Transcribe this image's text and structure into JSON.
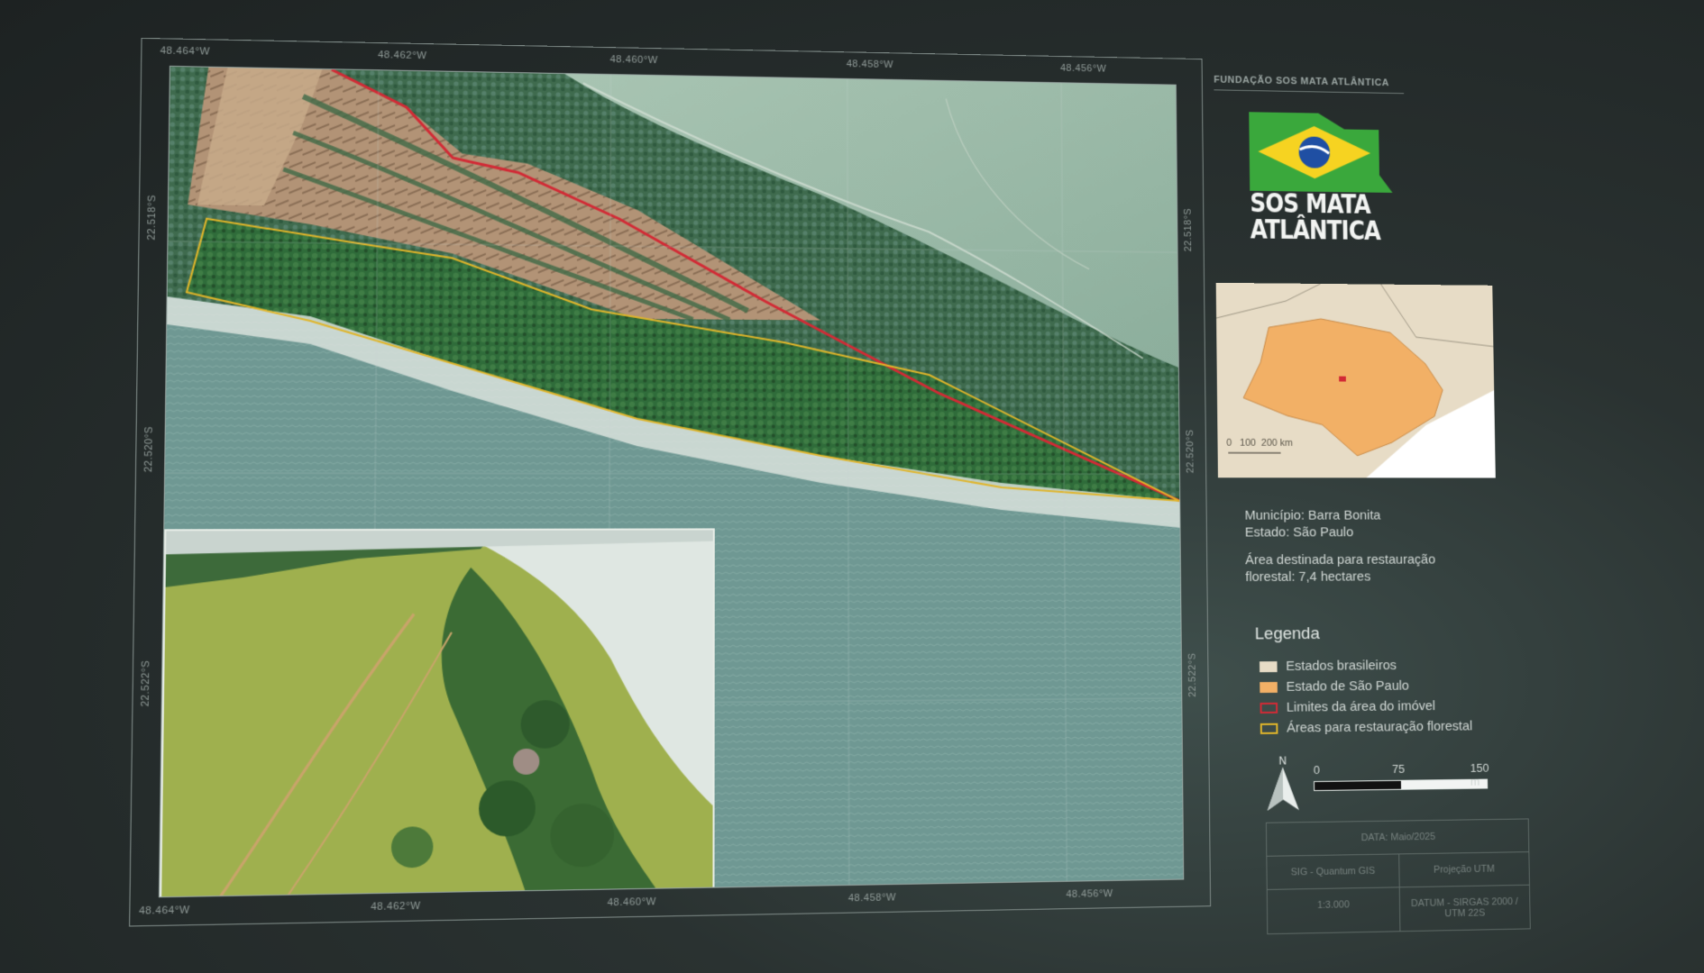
{
  "coords": {
    "top": [
      "48.464°W",
      "48.462°W",
      "48.460°W",
      "48.458°W",
      "48.456°W"
    ],
    "bottom": [
      "48.464°W",
      "48.462°W",
      "48.460°W",
      "48.458°W",
      "48.456°W"
    ],
    "left": [
      "22.518°S",
      "22.520°S",
      "22.522°S"
    ],
    "right": [
      "22.518°S",
      "22.520°S",
      "22.522°S"
    ]
  },
  "panel": {
    "org_name": "FUNDAÇÃO SOS MATA ATLÂNTICA",
    "logo_line1": "SOS MATA",
    "logo_line2": "ATLÂNTICA",
    "locator_scale": {
      "zero": "0",
      "mid": "100",
      "end": "200 km"
    },
    "municipio": "Município: Barra Bonita",
    "estado": "Estado: São Paulo",
    "area_line1": "Área destinada para restauração",
    "area_line2": "florestal: 7,4 hectares",
    "legend_title": "Legenda",
    "legend": [
      {
        "label": "Estados brasileiros",
        "color": "#e7dcc6",
        "style": "fill"
      },
      {
        "label": "Estado de São Paulo",
        "color": "#f2b066",
        "style": "fill"
      },
      {
        "label": "Limites da área do imóvel",
        "color": "#d22a35",
        "style": "outline"
      },
      {
        "label": "Áreas para restauração florestal",
        "color": "#e0b52a",
        "style": "outline"
      }
    ],
    "north_label": "N",
    "scale": {
      "zero": "0",
      "mid": "75",
      "end": "150 m"
    },
    "table": {
      "date": "DATA: Maio/2025",
      "sig": "SIG - Quantum GIS",
      "projection": "Projeção UTM",
      "ratio": "1:3.000",
      "datum": "DATUM - SIRGAS 2000 / UTM 22S"
    }
  },
  "colors": {
    "water": "#6f9893",
    "forest": "#3e6a4a",
    "pasture": "#9bb7a0",
    "soil": "#b59879",
    "restoration": "#2f6b38",
    "boundary": "#d22a35",
    "restoration_outline": "#e0b52a"
  }
}
